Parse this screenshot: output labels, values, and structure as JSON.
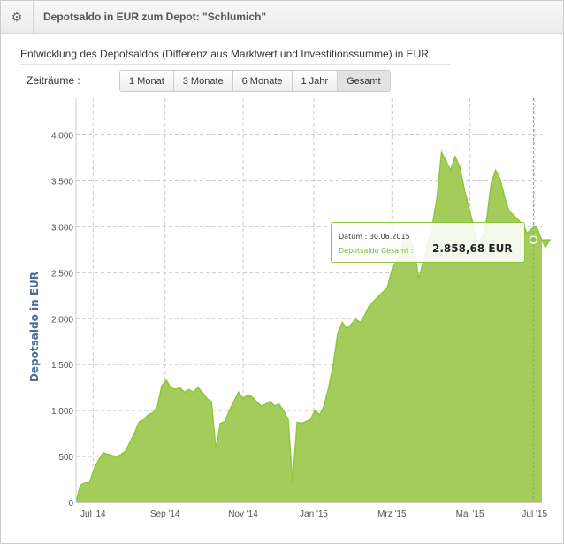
{
  "header": {
    "title": "Depotsaldo in EUR zum Depot: \"Schlumich\"",
    "icon": "gear-icon"
  },
  "subtitle": "Entwicklung des Depotsaldos (Differenz aus Marktwert und Investitionssumme) in EUR",
  "periods": {
    "label": "Zeiträume :",
    "options": [
      "1 Monat",
      "3 Monate",
      "6 Monate",
      "1 Jahr",
      "Gesamt"
    ],
    "selected": "Gesamt"
  },
  "tooltip": {
    "date_label": "Datum : 30.06.2015",
    "series_label": "Depotsaldo Gesamt :",
    "value": "2.858,68 EUR"
  },
  "colors": {
    "fill": "#a3cc5a",
    "line": "#8cc63f",
    "axis_label": "#4a6a9a"
  },
  "chart_data": {
    "type": "area",
    "ylabel": "Depotsaldo in EUR",
    "ylim": [
      0,
      4400
    ],
    "yticks": [
      0,
      500,
      1000,
      1500,
      2000,
      2500,
      3000,
      3500,
      4000
    ],
    "ytick_labels": [
      "0",
      "500",
      "1.000",
      "1.500",
      "2.000",
      "2.500",
      "3.000",
      "3.500",
      "4.000"
    ],
    "xlim": [
      "2014-06-20",
      "2015-07-07"
    ],
    "xticks": [
      "2014-07-04",
      "2014-09-01",
      "2014-11-04",
      "2015-01-01",
      "2015-03-06",
      "2015-05-09",
      "2015-07-01"
    ],
    "xtick_labels": [
      "Jul '14",
      "Sep '14",
      "Nov '14",
      "Jan '15",
      "Mrz '15",
      "Mai '15",
      "Jul '15"
    ],
    "series": [
      {
        "name": "Depotsaldo Gesamt",
        "start": "2014-06-20",
        "step_days": 3.7,
        "values": [
          0,
          190,
          215,
          215,
          365,
          460,
          540,
          525,
          510,
          500,
          520,
          560,
          660,
          760,
          877,
          900,
          955,
          975,
          1035,
          1270,
          1330,
          1250,
          1230,
          1250,
          1200,
          1230,
          1200,
          1250,
          1200,
          1130,
          1100,
          580,
          860,
          880,
          1005,
          1100,
          1200,
          1130,
          1170,
          1150,
          1100,
          1050,
          1070,
          1100,
          1050,
          1070,
          1000,
          905,
          215,
          870,
          860,
          880,
          905,
          1005,
          950,
          1055,
          1250,
          1500,
          1840,
          1960,
          1890,
          1940,
          1990,
          1960,
          2040,
          2140,
          2190,
          2240,
          2290,
          2335,
          2530,
          2630,
          2730,
          2925,
          2880,
          2730,
          2430,
          2630,
          2830,
          3025,
          3320,
          3810,
          3715,
          3615,
          3765,
          3660,
          3420,
          3220,
          3025,
          2830,
          2880,
          3075,
          3470,
          3615,
          3520,
          3320,
          3170,
          3125,
          3075,
          3025,
          2930,
          2980,
          3005,
          2880,
          2780,
          2858.68
        ]
      }
    ],
    "highlight": {
      "date": "2015-06-30",
      "value": 2858.68
    }
  }
}
